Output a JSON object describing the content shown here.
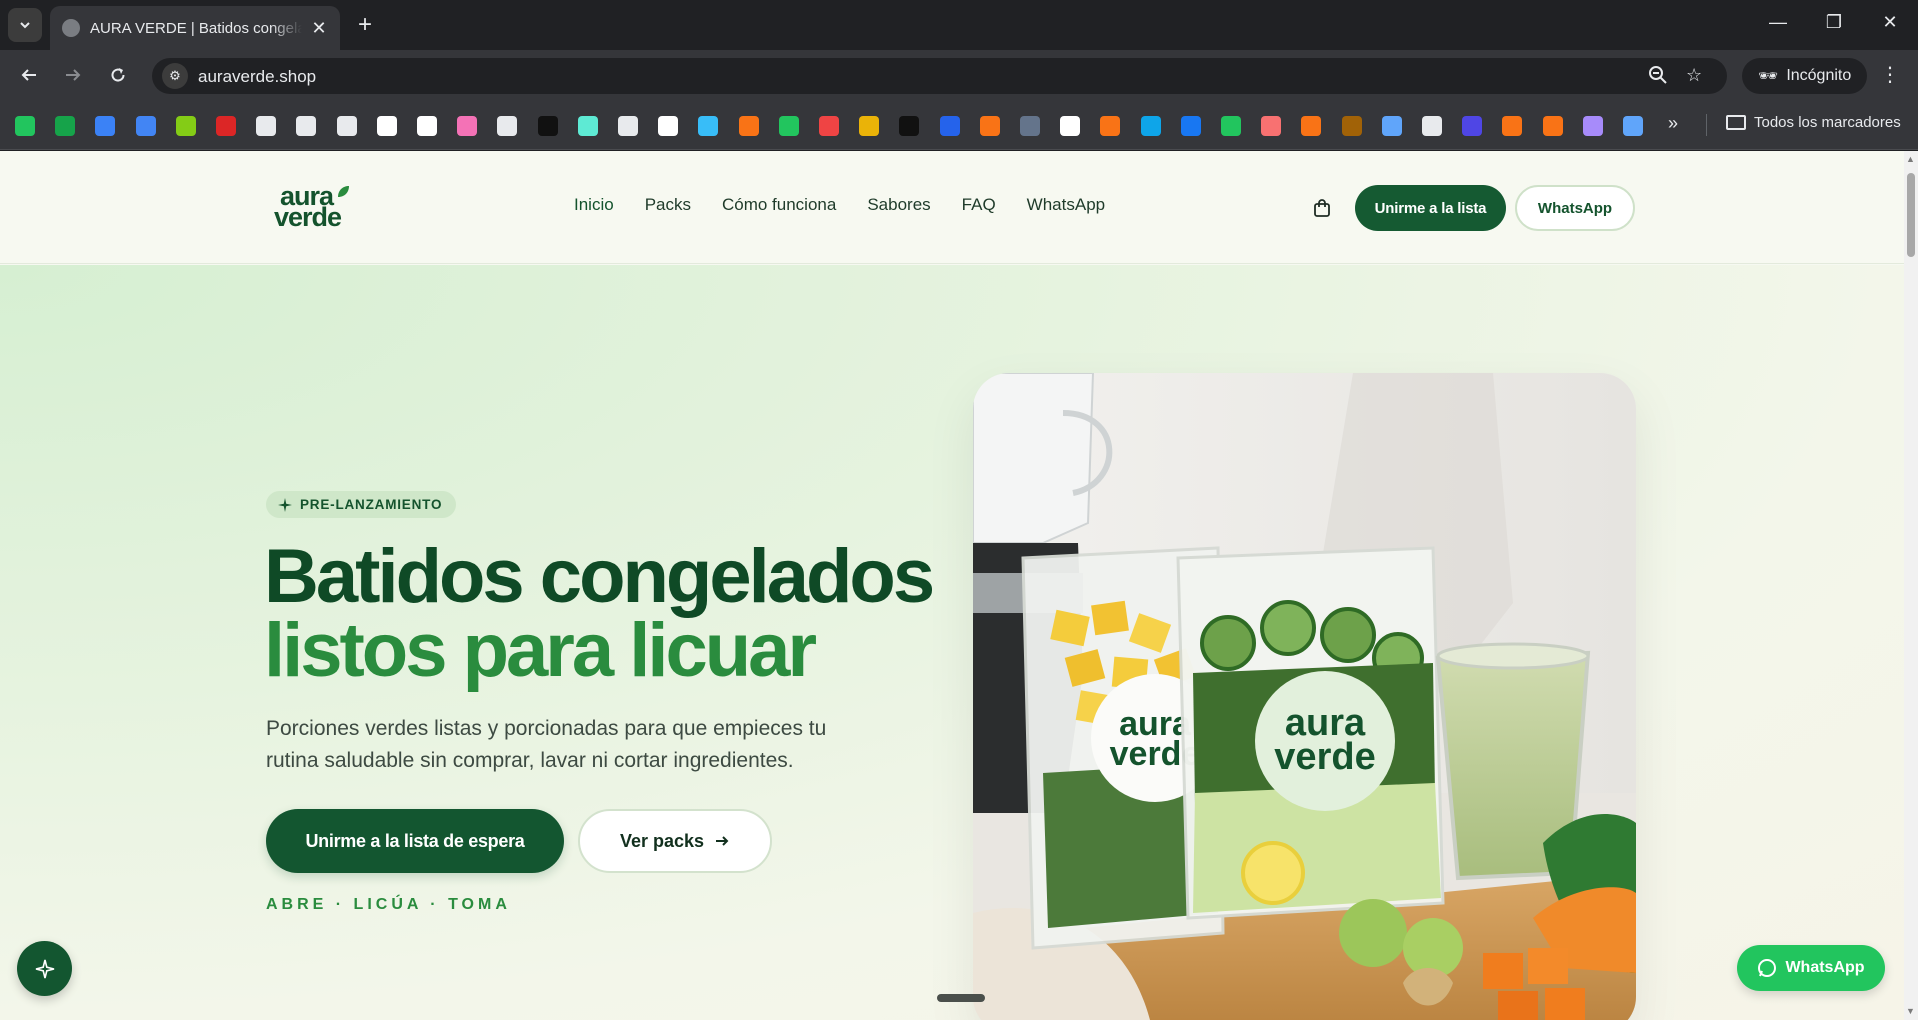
{
  "browser": {
    "tab_title": "AURA VERDE | Batidos congelados",
    "url": "auraverde.shop",
    "incognito_label": "Incógnito",
    "bookmarks_folder": "Todos los marcadores",
    "bookmark_icons": [
      "#22c55e",
      "#16a34a",
      "#3b82f6",
      "#4285f4",
      "#84cc16",
      "#dc2626",
      "#e8eaed",
      "#e8eaed",
      "#e8eaed",
      "#ffffff",
      "#ffffff",
      "#f472b6",
      "#e8eaed",
      "#111111",
      "#5eead4",
      "#e8eaed",
      "#ffffff",
      "#38bdf8",
      "#f97316",
      "#22c55e",
      "#ef4444",
      "#eab308",
      "#111111",
      "#2563eb",
      "#f97316",
      "#64748b",
      "#ffffff",
      "#f97316",
      "#0ea5e9",
      "#1877f2",
      "#22c55e",
      "#f87171",
      "#f97316",
      "#a16207",
      "#60a5fa",
      "#e8eaed",
      "#4f46e5",
      "#f97316",
      "#f97316",
      "#a78bfa",
      "#60a5fa"
    ]
  },
  "site": {
    "logo_top": "aura",
    "logo_bottom": "verde",
    "nav": [
      "Inicio",
      "Packs",
      "Cómo funciona",
      "Sabores",
      "FAQ",
      "WhatsApp"
    ],
    "header_join": "Unirme a la lista",
    "header_whatsapp": "WhatsApp"
  },
  "hero": {
    "badge": "PRE-LANZAMIENTO",
    "title_line1": "Batidos congelados",
    "title_line2": "listos para licuar",
    "subtitle": "Porciones verdes listas y porcionadas para que empieces tu rutina saludable sin comprar, lavar ni cortar ingredientes.",
    "cta_primary": "Unirme a la lista de espera",
    "cta_secondary": "Ver packs",
    "tagline": "ABRE · LICÚA · TOMA",
    "bag_label_top": "aura",
    "bag_label_bottom": "verde"
  },
  "floating": {
    "whatsapp": "WhatsApp"
  },
  "colors": {
    "brand_dark": "#135630",
    "brand_green": "#2a8c3e",
    "whatsapp": "#22c55e"
  }
}
